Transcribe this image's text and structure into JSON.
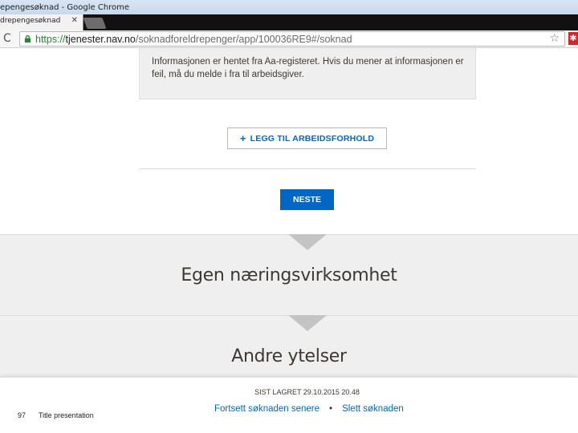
{
  "window": {
    "title": "epengesøknad - Google Chrome"
  },
  "tab": {
    "label": "drepengesøknad",
    "close_glyph": "✕"
  },
  "toolbar": {
    "reload_glyph": "C",
    "url_scheme": "https://",
    "url_host": "tjenester.nav.no",
    "url_path": "/soknadforeldrepenger/app/100036RE9#/soknad",
    "star_glyph": "☆",
    "extension_glyph": "✱"
  },
  "info_box": {
    "text": "Informasjonen er hentet fra Aa-registeret. Hvis du mener at informasjonen er feil, må du melde i fra til arbeidsgiver."
  },
  "add_button": {
    "icon": "+",
    "label": "LEGG TIL ARBEIDSFORHOLD"
  },
  "next_button": {
    "label": "NESTE"
  },
  "sections": [
    {
      "title": "Egen næringsvirksomhet"
    },
    {
      "title": "Andre ytelser"
    }
  ],
  "footer": {
    "saved_text": "SIST LAGRET 29.10.2015 20.48",
    "continue_later": "Fortsett søknaden senere",
    "separator": "•",
    "delete": "Slett søknaden"
  },
  "slide": {
    "number": "97",
    "title": "Title presentation"
  },
  "colors": {
    "accent_blue": "#0067c5",
    "secure_green": "#1e8a2b",
    "panel_grey": "#efefef",
    "text_dark": "#3e3832"
  }
}
